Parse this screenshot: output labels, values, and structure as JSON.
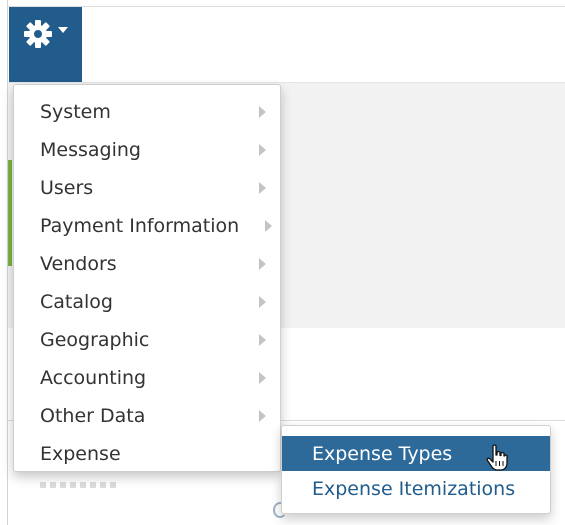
{
  "settings_button": {
    "icon": "gear-icon",
    "caret_icon": "caret-down-icon",
    "color": "#215c8c"
  },
  "menu": {
    "items": [
      {
        "label": "System",
        "has_submenu": true
      },
      {
        "label": "Messaging",
        "has_submenu": true
      },
      {
        "label": "Users",
        "has_submenu": true
      },
      {
        "label": "Payment Information",
        "has_submenu": true
      },
      {
        "label": "Vendors",
        "has_submenu": true
      },
      {
        "label": "Catalog",
        "has_submenu": true
      },
      {
        "label": "Geographic",
        "has_submenu": true
      },
      {
        "label": "Accounting",
        "has_submenu": true
      },
      {
        "label": "Other Data",
        "has_submenu": true
      },
      {
        "label": "Expense",
        "has_submenu": false
      }
    ]
  },
  "submenu": {
    "items": [
      {
        "label": "Expense Types",
        "active": true
      },
      {
        "label": "Expense Itemizations",
        "active": false
      }
    ],
    "active_bg": "#2d6a9a",
    "link_color": "#215c8c"
  },
  "cursor": "hand-pointer-icon"
}
